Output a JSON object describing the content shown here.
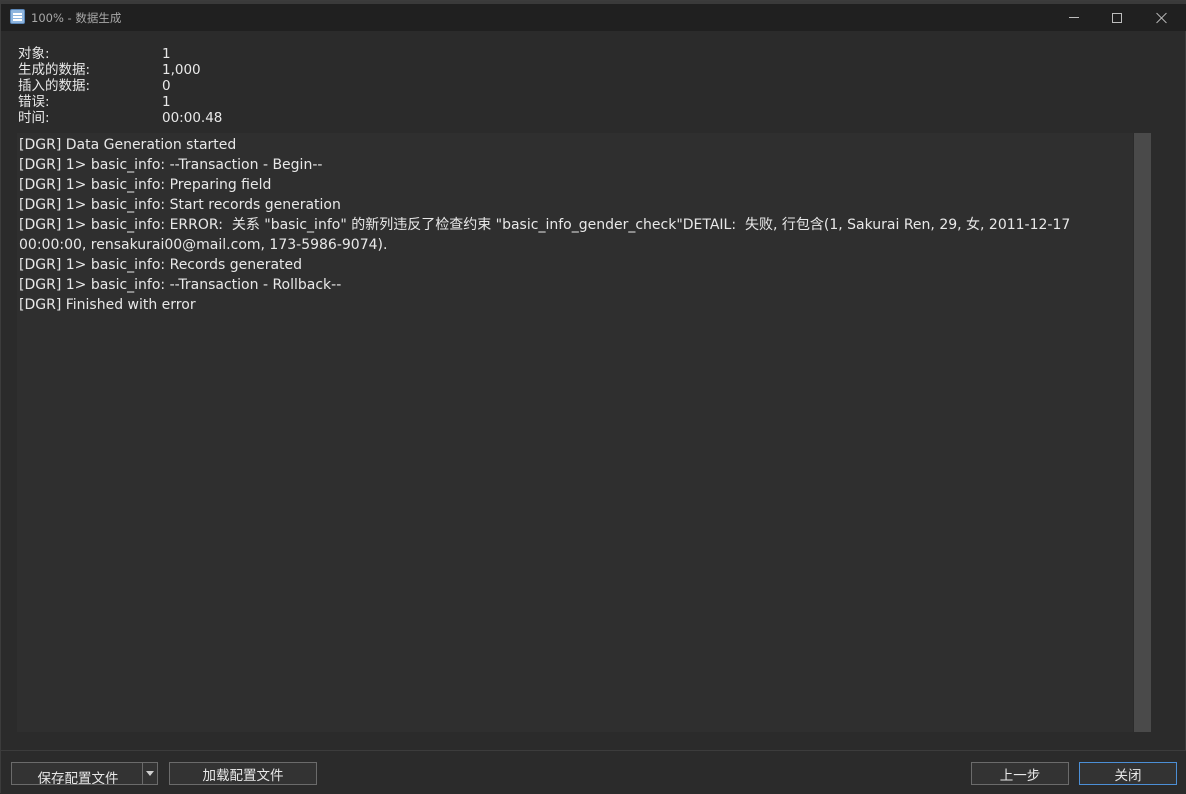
{
  "window": {
    "title": "100% - 数据生成"
  },
  "stats": [
    {
      "label": "对象:",
      "value": "1"
    },
    {
      "label": "生成的数据:",
      "value": "1,000"
    },
    {
      "label": "插入的数据:",
      "value": "0"
    },
    {
      "label": "错误:",
      "value": "1"
    },
    {
      "label": "时间:",
      "value": "00:00.48"
    }
  ],
  "log": [
    "[DGR] Data Generation started",
    "[DGR] 1> basic_info: --Transaction - Begin--",
    "[DGR] 1> basic_info: Preparing field",
    "[DGR] 1> basic_info: Start records generation",
    "[DGR] 1> basic_info: ERROR:  关系 \"basic_info\" 的新列违反了检查约束 \"basic_info_gender_check\"DETAIL:  失败, 行包含(1, Sakurai Ren, 29, 女, 2011-12-17 00:00:00, rensakurai00@mail.com, 173-5986-9074).",
    "[DGR] 1> basic_info: Records generated",
    "[DGR] 1> basic_info: --Transaction - Rollback--",
    "[DGR] Finished with error"
  ],
  "footer": {
    "save_config_label": "保存配置文件",
    "load_config_label": "加载配置文件",
    "prev_label": "上一步",
    "close_label": "关闭"
  },
  "colors": {
    "background": "#2b2b2b",
    "titlebar": "#202020",
    "accent_border": "#4c8fd6"
  },
  "icons": {
    "app": "database-icon",
    "minimize": "minimize-icon",
    "maximize": "maximize-icon",
    "close": "close-icon",
    "dropdown": "chevron-down-icon"
  }
}
